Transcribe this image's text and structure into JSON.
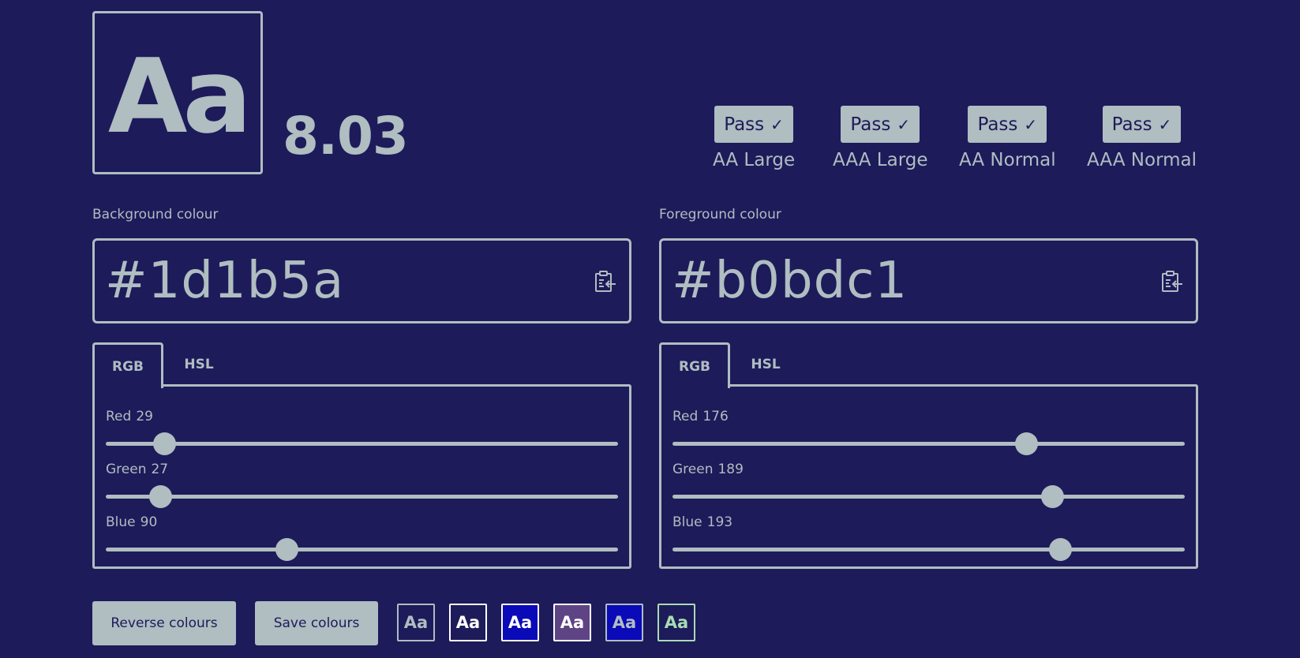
{
  "preview": {
    "text": "Aa"
  },
  "contrast_ratio": "8.03",
  "checks": [
    {
      "badge": "Pass",
      "label": "AA Large"
    },
    {
      "badge": "Pass",
      "label": "AAA Large"
    },
    {
      "badge": "Pass",
      "label": "AA Normal"
    },
    {
      "badge": "Pass",
      "label": "AAA Normal"
    }
  ],
  "background": {
    "label": "Background colour",
    "hex": "#1d1b5a",
    "tabs": [
      "RGB",
      "HSL"
    ],
    "active_tab": "RGB",
    "sliders": [
      {
        "name": "Red",
        "value": 29,
        "max": 255
      },
      {
        "name": "Green",
        "value": 27,
        "max": 255
      },
      {
        "name": "Blue",
        "value": 90,
        "max": 255
      }
    ]
  },
  "foreground": {
    "label": "Foreground colour",
    "hex": "#b0bdc1",
    "tabs": [
      "RGB",
      "HSL"
    ],
    "active_tab": "RGB",
    "sliders": [
      {
        "name": "Red",
        "value": 176,
        "max": 255
      },
      {
        "name": "Green",
        "value": 189,
        "max": 255
      },
      {
        "name": "Blue",
        "value": 193,
        "max": 255
      }
    ]
  },
  "buttons": {
    "reverse": "Reverse colours",
    "save": "Save colours"
  },
  "saved_swatches": [
    {
      "text": "Aa",
      "bg": "#1d1b5a",
      "fg": "#b0bdc1"
    },
    {
      "text": "Aa",
      "bg": "#1d1b5a",
      "fg": "#ffffff"
    },
    {
      "text": "Aa",
      "bg": "#0a0ab8",
      "fg": "#ffffff"
    },
    {
      "text": "Aa",
      "bg": "#5e4485",
      "fg": "#ffffff"
    },
    {
      "text": "Aa",
      "bg": "#0a0ab8",
      "fg": "#b0bdc1"
    },
    {
      "text": "Aa",
      "bg": "#1d1b5a",
      "fg": "#a8dcb4"
    }
  ],
  "colors": {
    "page_bg": "#1d1b5a",
    "accent": "#b0bdc1"
  }
}
